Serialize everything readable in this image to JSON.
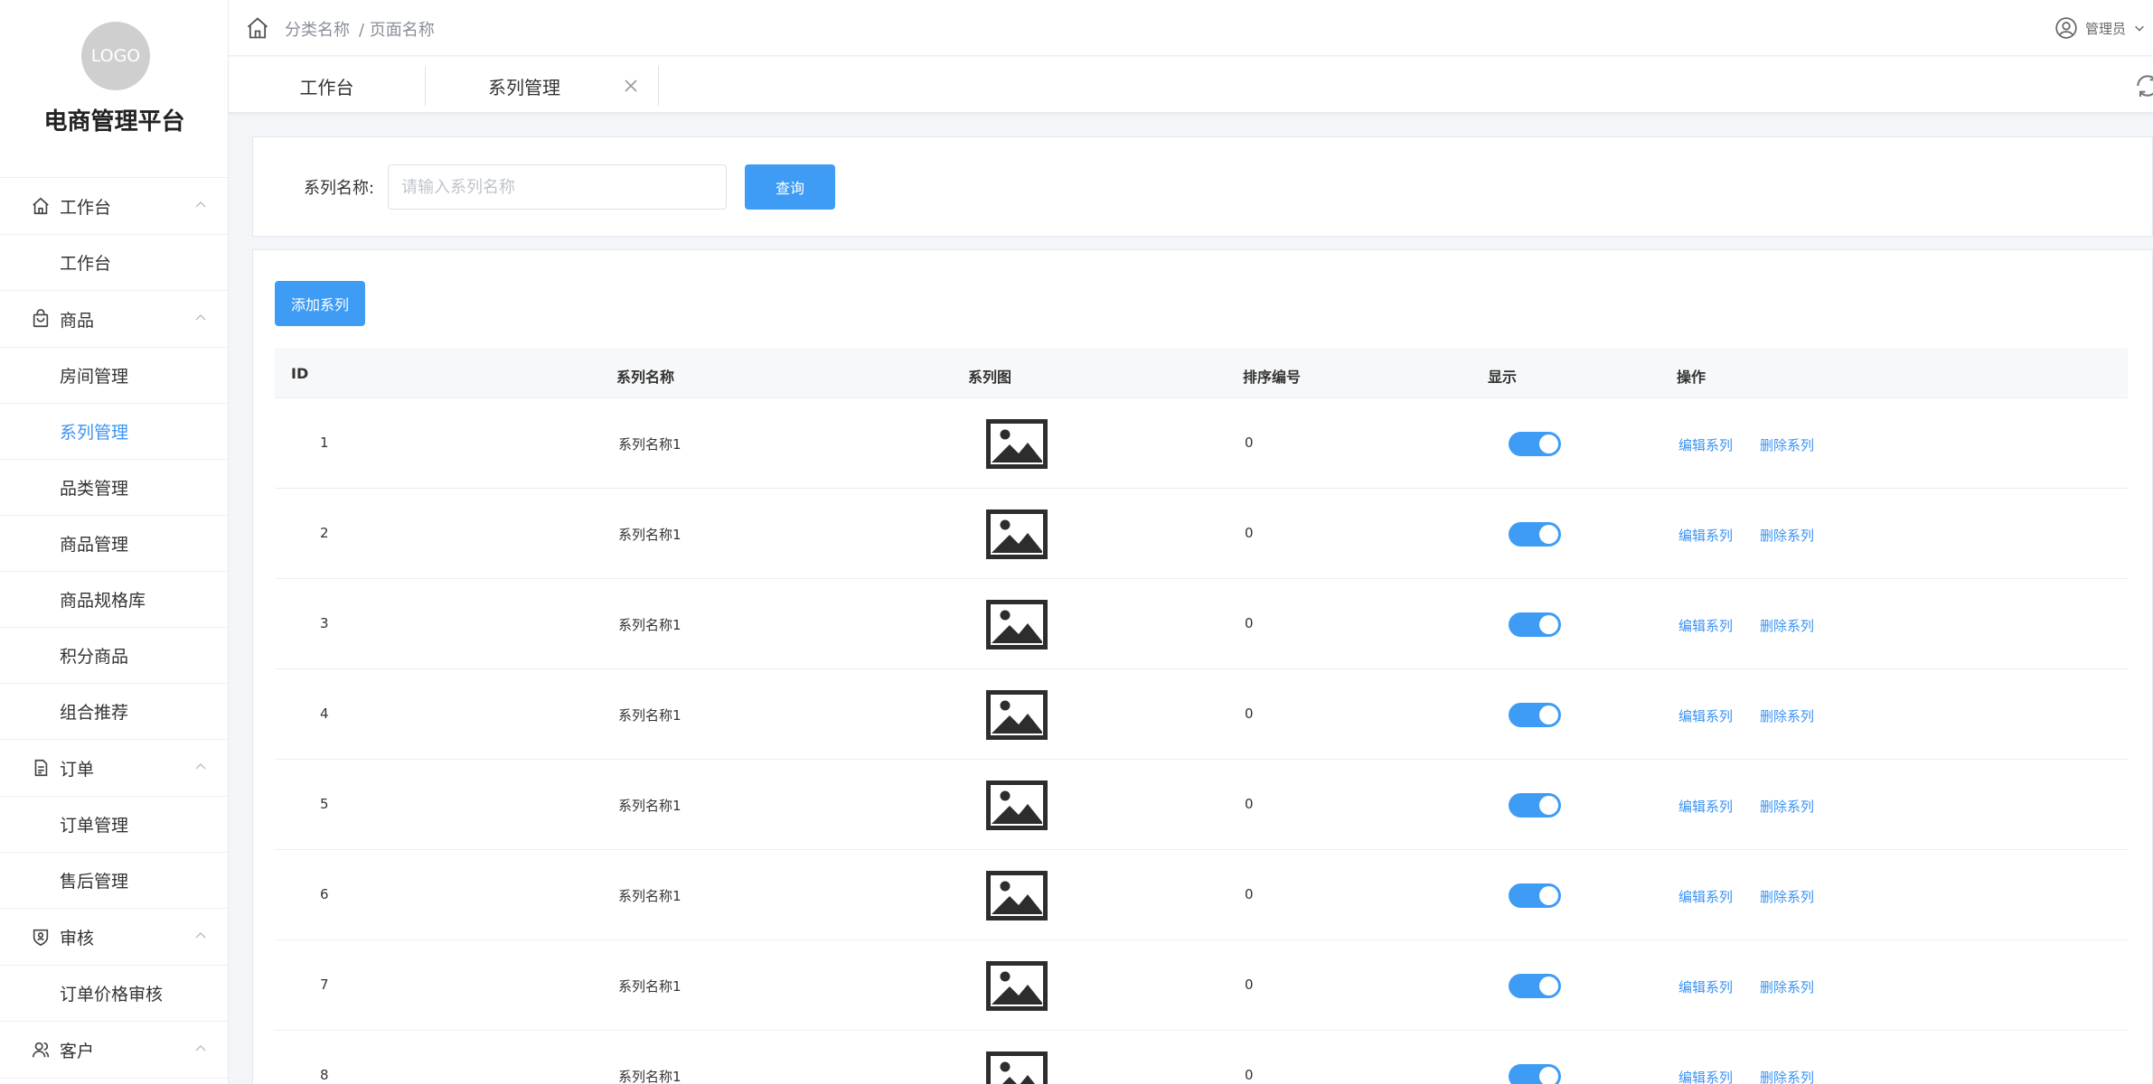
{
  "sidebar": {
    "logo": "LOGO",
    "brand": "电商管理平台",
    "groups": [
      {
        "label": "工作台",
        "icon": "home-icon",
        "items": [
          "工作台"
        ]
      },
      {
        "label": "商品",
        "icon": "shopping-bag-icon",
        "items": [
          "房间管理",
          "系列管理",
          "品类管理",
          "商品管理",
          "商品规格库",
          "积分商品",
          "组合推荐"
        ]
      },
      {
        "label": "订单",
        "icon": "document-icon",
        "items": [
          "订单管理",
          "售后管理"
        ]
      },
      {
        "label": "审核",
        "icon": "shield-icon",
        "items": [
          "订单价格审核"
        ]
      },
      {
        "label": "客户",
        "icon": "user-icon",
        "items": []
      }
    ],
    "active_item": "系列管理"
  },
  "header": {
    "breadcrumb": [
      "分类名称",
      "/ 页面名称"
    ],
    "user": "管理员"
  },
  "tabs": [
    {
      "label": "工作台"
    },
    {
      "label": "系列管理",
      "closable": true
    }
  ],
  "search": {
    "label": "系列名称:",
    "placeholder": "请输入系列名称",
    "button": "查询"
  },
  "table": {
    "add_button": "添加系列",
    "headers": [
      "ID",
      "系列名称",
      "系列图",
      "排序编号",
      "显示",
      "操作"
    ],
    "rows": [
      {
        "id": "1",
        "name": "系列名称1",
        "sort": "0",
        "show": true
      },
      {
        "id": "2",
        "name": "系列名称1",
        "sort": "0",
        "show": true
      },
      {
        "id": "3",
        "name": "系列名称1",
        "sort": "0",
        "show": true
      },
      {
        "id": "4",
        "name": "系列名称1",
        "sort": "0",
        "show": true
      },
      {
        "id": "5",
        "name": "系列名称1",
        "sort": "0",
        "show": true
      },
      {
        "id": "6",
        "name": "系列名称1",
        "sort": "0",
        "show": true
      },
      {
        "id": "7",
        "name": "系列名称1",
        "sort": "0",
        "show": true
      },
      {
        "id": "8",
        "name": "系列名称1",
        "sort": "0",
        "show": true
      }
    ],
    "actions": {
      "edit": "编辑系列",
      "delete": "删除系列"
    }
  },
  "colors": {
    "primary": "#3f9cf5",
    "link": "#3b93f2",
    "background": "#f3f5f8"
  }
}
